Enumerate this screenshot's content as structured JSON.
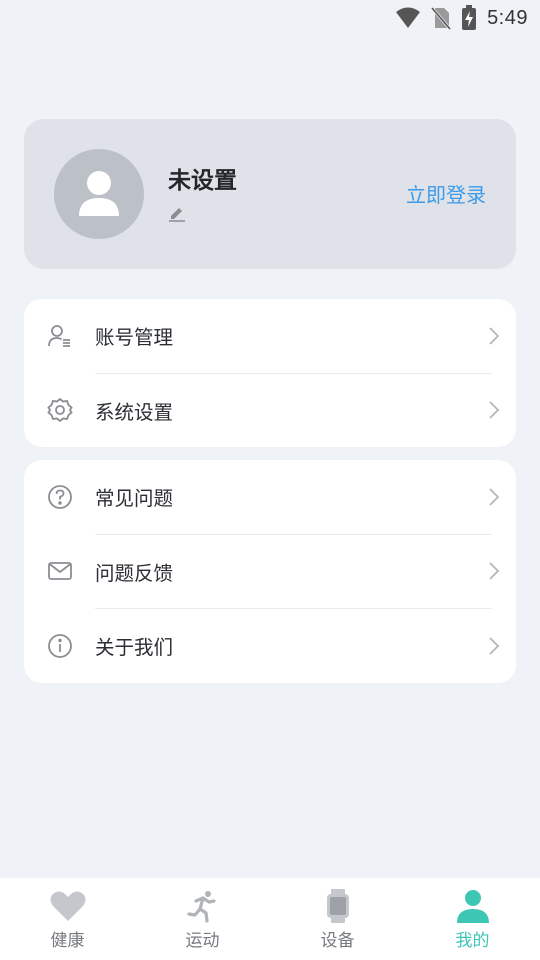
{
  "status_bar": {
    "time": "5:49"
  },
  "profile": {
    "name": "未设置",
    "login_label": "立即登录",
    "icons": {
      "avatar": "person-icon",
      "edit": "pencil-icon"
    }
  },
  "menu_group_1": [
    {
      "label": "账号管理",
      "icon": "user-account-icon"
    },
    {
      "label": "系统设置",
      "icon": "gear-icon"
    }
  ],
  "menu_group_2": [
    {
      "label": "常见问题",
      "icon": "question-circle-icon"
    },
    {
      "label": "问题反馈",
      "icon": "envelope-icon"
    },
    {
      "label": "关于我们",
      "icon": "info-circle-icon"
    }
  ],
  "bottom_nav": [
    {
      "label": "健康",
      "icon": "heart-icon",
      "active": false
    },
    {
      "label": "运动",
      "icon": "running-icon",
      "active": false
    },
    {
      "label": "设备",
      "icon": "watch-icon",
      "active": false
    },
    {
      "label": "我的",
      "icon": "person-icon",
      "active": true
    }
  ],
  "colors": {
    "background": "#eff2f6",
    "profile_card": "#dfe2e8",
    "accent_link": "#3d9be9",
    "active_tab": "#3ec6b4",
    "inactive_icon": "#c4c7cc"
  }
}
